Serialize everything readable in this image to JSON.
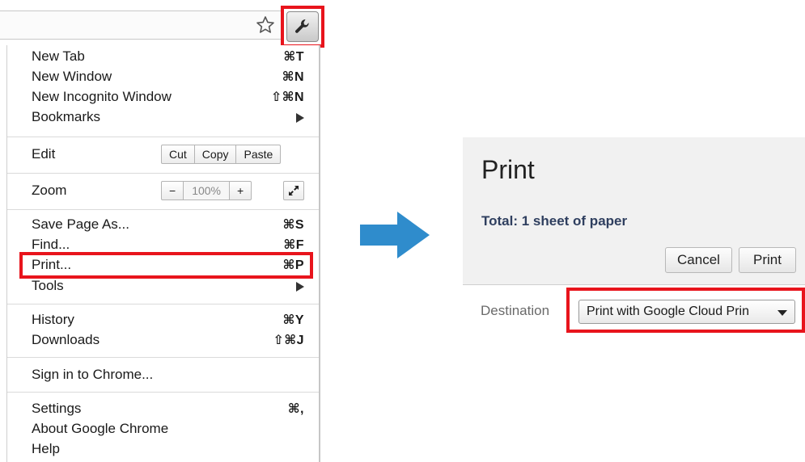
{
  "toolbar": {
    "star_icon": "star-icon",
    "wrench_icon": "wrench-icon"
  },
  "menu": {
    "new_tab": {
      "label": "New Tab",
      "shortcut": "⌘T"
    },
    "new_window": {
      "label": "New Window",
      "shortcut": "⌘N"
    },
    "new_incognito": {
      "label": "New Incognito Window",
      "shortcut": "⇧⌘N"
    },
    "bookmarks": {
      "label": "Bookmarks"
    },
    "edit": {
      "label": "Edit",
      "cut": "Cut",
      "copy": "Copy",
      "paste": "Paste"
    },
    "zoom": {
      "label": "Zoom",
      "minus": "−",
      "value": "100%",
      "plus": "+"
    },
    "save_page": {
      "label": "Save Page As...",
      "shortcut": "⌘S"
    },
    "find": {
      "label": "Find...",
      "shortcut": "⌘F"
    },
    "print": {
      "label": "Print...",
      "shortcut": "⌘P"
    },
    "tools": {
      "label": "Tools"
    },
    "history": {
      "label": "History",
      "shortcut": "⌘Y"
    },
    "downloads": {
      "label": "Downloads",
      "shortcut": "⇧⌘J"
    },
    "sign_in": {
      "label": "Sign in to Chrome..."
    },
    "settings": {
      "label": "Settings",
      "shortcut": "⌘,"
    },
    "about": {
      "label": "About Google Chrome"
    },
    "help": {
      "label": "Help"
    }
  },
  "print_preview": {
    "title": "Print",
    "total": "Total: 1 sheet of paper",
    "cancel_label": "Cancel",
    "print_label": "Print",
    "destination_label": "Destination",
    "destination_value": "Print with Google Cloud Prin"
  },
  "colors": {
    "highlight": "#e8141c",
    "arrow": "#2f8ccc",
    "panel_bg": "#f1f1f1"
  }
}
